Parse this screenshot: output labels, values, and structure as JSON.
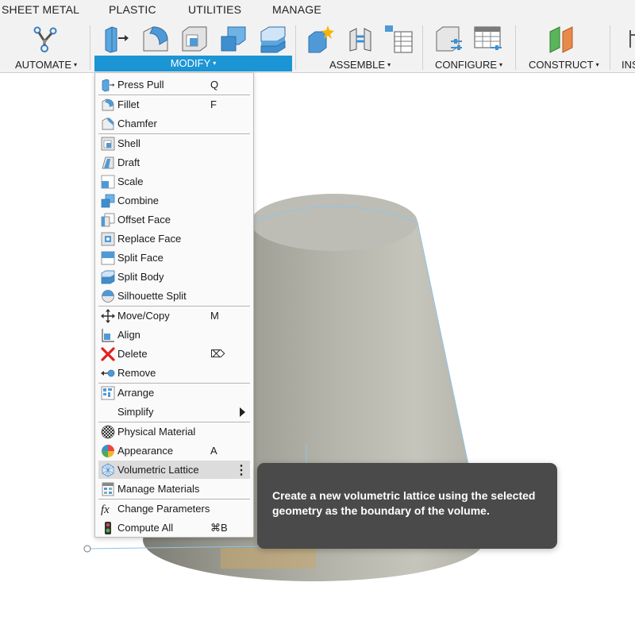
{
  "ribbon": {
    "tabs": [
      "SHEET METAL",
      "PLASTIC",
      "UTILITIES",
      "MANAGE"
    ],
    "groups": {
      "automate": "AUTOMATE",
      "modify": "MODIFY",
      "assemble": "ASSEMBLE",
      "configure": "CONFIGURE",
      "construct": "CONSTRUCT",
      "inspect": "INS"
    },
    "dropdown_caret": "▾"
  },
  "modify_menu": {
    "items": [
      {
        "label": "Press Pull",
        "shortcut": "Q",
        "icon": "press-pull-icon"
      },
      {
        "label": "Fillet",
        "shortcut": "F",
        "icon": "fillet-icon"
      },
      {
        "label": "Chamfer",
        "shortcut": "",
        "icon": "chamfer-icon"
      },
      {
        "label": "Shell",
        "shortcut": "",
        "icon": "shell-icon"
      },
      {
        "label": "Draft",
        "shortcut": "",
        "icon": "draft-icon"
      },
      {
        "label": "Scale",
        "shortcut": "",
        "icon": "scale-icon"
      },
      {
        "label": "Combine",
        "shortcut": "",
        "icon": "combine-icon"
      },
      {
        "label": "Offset Face",
        "shortcut": "",
        "icon": "offset-face-icon"
      },
      {
        "label": "Replace Face",
        "shortcut": "",
        "icon": "replace-face-icon"
      },
      {
        "label": "Split Face",
        "shortcut": "",
        "icon": "split-face-icon"
      },
      {
        "label": "Split Body",
        "shortcut": "",
        "icon": "split-body-icon"
      },
      {
        "label": "Silhouette Split",
        "shortcut": "",
        "icon": "silhouette-split-icon"
      },
      {
        "label": "Move/Copy",
        "shortcut": "M",
        "icon": "move-copy-icon"
      },
      {
        "label": "Align",
        "shortcut": "",
        "icon": "align-icon"
      },
      {
        "label": "Delete",
        "shortcut": "⌦",
        "icon": "delete-icon"
      },
      {
        "label": "Remove",
        "shortcut": "",
        "icon": "remove-icon"
      },
      {
        "label": "Arrange",
        "shortcut": "",
        "icon": "arrange-icon"
      },
      {
        "label": "Simplify",
        "shortcut": "",
        "icon": "",
        "submenu": true
      },
      {
        "label": "Physical Material",
        "shortcut": "",
        "icon": "physical-material-icon"
      },
      {
        "label": "Appearance",
        "shortcut": "A",
        "icon": "appearance-icon"
      },
      {
        "label": "Volumetric Lattice",
        "shortcut": "",
        "icon": "volumetric-lattice-icon",
        "highlighted": true
      },
      {
        "label": "Manage Materials",
        "shortcut": "",
        "icon": "manage-materials-icon"
      },
      {
        "label": "Change Parameters",
        "shortcut": "",
        "icon": "change-parameters-icon"
      },
      {
        "label": "Compute All",
        "shortcut": "⌘B",
        "icon": "compute-all-icon"
      }
    ]
  },
  "tooltip": {
    "text": "Create a new volumetric lattice using the selected geometry as the boundary of the volume."
  },
  "colors": {
    "accent": "#1c95d5",
    "tooltip_bg": "#4a4a4a",
    "highlight_row": "#dcdcdc",
    "model_body": "#a9a89f"
  }
}
